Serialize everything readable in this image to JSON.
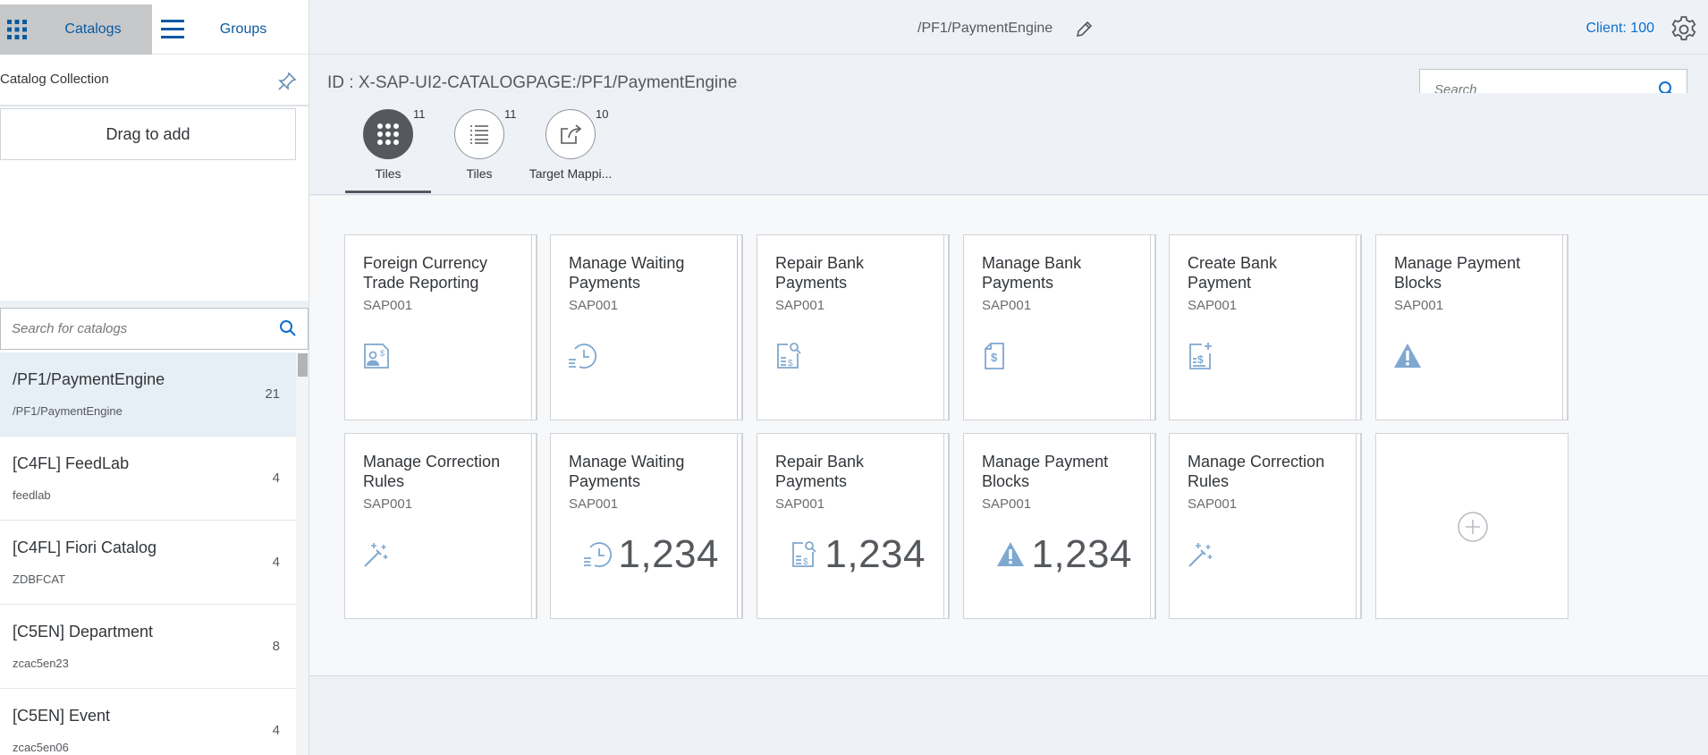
{
  "sidebar": {
    "tabs": {
      "catalogs": "Catalogs",
      "groups": "Groups"
    },
    "collection_title": "Catalog Collection",
    "drag_to_add": "Drag to add",
    "search_placeholder": "Search for catalogs",
    "catalogs": [
      {
        "name": "/PF1/PaymentEngine",
        "sub": "/PF1/PaymentEngine",
        "count": "21",
        "selected": true
      },
      {
        "name": "[C4FL] FeedLab",
        "sub": "feedlab",
        "count": "4"
      },
      {
        "name": "[C4FL] Fiori Catalog",
        "sub": "ZDBFCAT",
        "count": "4"
      },
      {
        "name": "[C5EN] Department",
        "sub": "zcac5en23",
        "count": "8"
      },
      {
        "name": "[C5EN] Event",
        "sub": "zcac5en06",
        "count": "4"
      }
    ]
  },
  "header": {
    "title": "/PF1/PaymentEngine",
    "client": "Client: 100"
  },
  "main": {
    "catalog_id": "ID : X-SAP-UI2-CATALOGPAGE:/PF1/PaymentEngine",
    "search_placeholder": "Search",
    "tabs": [
      {
        "label": "Tiles",
        "count": "11",
        "icon": "grid-icon",
        "active": true
      },
      {
        "label": "Tiles",
        "count": "11",
        "icon": "list-icon"
      },
      {
        "label": "Target Mappi...",
        "count": "10",
        "icon": "share-icon"
      }
    ],
    "tiles": [
      {
        "title": "Foreign Currency Trade Reporting",
        "sub": "SAP001",
        "icon": "document-person-icon"
      },
      {
        "title": "Manage Waiting Payments",
        "sub": "SAP001",
        "icon": "history-icon"
      },
      {
        "title": "Repair Bank Payments",
        "sub": "SAP001",
        "icon": "document-search-icon"
      },
      {
        "title": "Manage Bank Payments",
        "sub": "SAP001",
        "icon": "document-dollar-icon"
      },
      {
        "title": "Create Bank Payment",
        "sub": "SAP001",
        "icon": "document-add-dollar-icon"
      },
      {
        "title": "Manage Payment Blocks",
        "sub": "SAP001",
        "icon": "warning-icon"
      },
      {
        "title": "Manage Correction Rules",
        "sub": "SAP001",
        "icon": "magic-wand-icon"
      },
      {
        "title": "Manage Waiting Payments",
        "sub": "SAP001",
        "icon": "history-icon",
        "kpi": "1,234"
      },
      {
        "title": "Repair Bank Payments",
        "sub": "SAP001",
        "icon": "document-search-icon",
        "kpi": "1,234"
      },
      {
        "title": "Manage Payment Blocks",
        "sub": "SAP001",
        "icon": "warning-icon",
        "kpi": "1,234"
      },
      {
        "title": "Manage Correction Rules",
        "sub": "SAP001",
        "icon": "magic-wand-icon"
      }
    ]
  },
  "colors": {
    "accent": "#0a6ed1",
    "icon": "#7fa8d0",
    "selected_row": "#e6eef6"
  }
}
